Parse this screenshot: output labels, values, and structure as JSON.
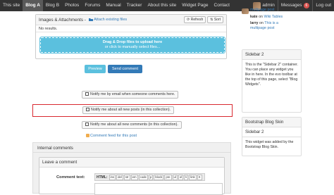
{
  "nav": {
    "items": [
      {
        "label": "This site",
        "active": false
      },
      {
        "label": "Blog A",
        "active": true
      },
      {
        "label": "Blog B",
        "active": false
      },
      {
        "label": "Photos",
        "active": false
      },
      {
        "label": "Forums",
        "active": false
      },
      {
        "label": "Manual",
        "active": false
      },
      {
        "label": "Tracker",
        "active": false
      },
      {
        "label": "About this site",
        "active": false
      },
      {
        "label": "Widget Page",
        "active": false
      },
      {
        "label": "Contact",
        "active": false
      }
    ],
    "user": "admin",
    "messages_label": "Messages",
    "messages_count": "6",
    "logout_label": "Log out"
  },
  "attachments": {
    "title": "Images & Attachments -",
    "attach_link": "Attach existing files",
    "refresh_label": "Refresh",
    "sort_label": "Sort",
    "no_results": "No results.",
    "drop_line1": "Drag & Drop files to upload here",
    "drop_line2": "or click to manually select files..."
  },
  "actions": {
    "preview_label": "Preview",
    "send_label": "Send comment"
  },
  "notify": {
    "email_label": "Notify me by email when someone comments here.",
    "posts_label": "Notify me about all new posts (in this collection).",
    "comments_label": "Notify me about all new comments (in this collection)."
  },
  "feed_link": "Comment feed for this post",
  "internal": {
    "title": "Internal comments",
    "leave_title": "Leave a comment",
    "comment_label": "Comment text:",
    "html_label": "HTML:",
    "toolbar": [
      "ins",
      "del",
      "str",
      "em",
      "code",
      "p",
      "block",
      "pre",
      "ul",
      "ol",
      "li",
      "link",
      "X"
    ]
  },
  "sidebar": {
    "recent": [
      {
        "text": "multipage post"
      },
      {
        "user": "kate",
        "mid": "on",
        "link": "Wiki Tables"
      },
      {
        "user": "larry",
        "mid": "on",
        "link": "This is a"
      },
      {
        "text": "multipage post"
      }
    ],
    "sidebar2_title": "Sidebar 2",
    "sidebar2_body": "This is the \"Sidebar 2\" container. You can place any widget you like in here. In the evo toolbar at the top of this page, select \"Blog Widgets\".",
    "skin_title": "Bootstrap Blog Skin",
    "skin_sub": "Sidebar 2",
    "skin_body": "This widget was added by the Bootstrap Blog Skin."
  },
  "colors": {
    "nav_bg": "#333333",
    "primary": "#337ab7",
    "info": "#5bc0de",
    "highlight": "#d9282f"
  }
}
